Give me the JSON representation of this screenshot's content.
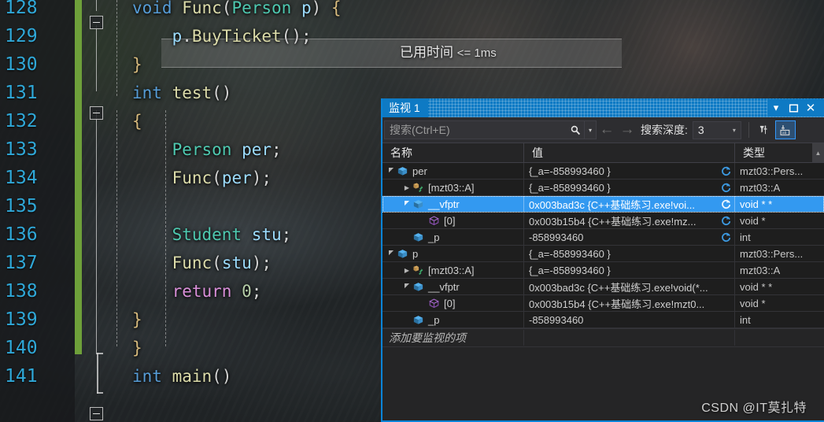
{
  "editor": {
    "elapsed_annotation": "已用时间",
    "elapsed_value": "<= 1ms",
    "lines": [
      {
        "no": "128",
        "indent": 0,
        "tokens": [
          {
            "t": "void ",
            "c": "kw"
          },
          {
            "t": "Func",
            "c": "fn"
          },
          {
            "t": "(",
            "c": "punct"
          },
          {
            "t": "Person",
            "c": "type"
          },
          {
            "t": " p",
            "c": "var"
          },
          {
            "t": ") ",
            "c": "punct"
          },
          {
            "t": "{",
            "c": "brace"
          }
        ]
      },
      {
        "no": "129",
        "indent": 0,
        "tokens": [
          {
            "t": "    p",
            "c": "var"
          },
          {
            "t": ".",
            "c": "punct"
          },
          {
            "t": "BuyTicket",
            "c": "fn"
          },
          {
            "t": "();",
            "c": "punct"
          }
        ]
      },
      {
        "no": "130",
        "indent": 0,
        "tokens": [
          {
            "t": "}",
            "c": "brace"
          }
        ]
      },
      {
        "no": "131",
        "indent": 0,
        "tokens": [
          {
            "t": "int ",
            "c": "kw"
          },
          {
            "t": "test",
            "c": "fn"
          },
          {
            "t": "()",
            "c": "punct"
          }
        ]
      },
      {
        "no": "132",
        "indent": 0,
        "tokens": [
          {
            "t": "{",
            "c": "brace"
          }
        ]
      },
      {
        "no": "133",
        "indent": 0,
        "tokens": [
          {
            "t": "    Person",
            "c": "type"
          },
          {
            "t": " per",
            "c": "var"
          },
          {
            "t": ";",
            "c": "punct"
          }
        ]
      },
      {
        "no": "134",
        "indent": 0,
        "tokens": [
          {
            "t": "    Func",
            "c": "fn"
          },
          {
            "t": "(",
            "c": "punct"
          },
          {
            "t": "per",
            "c": "var"
          },
          {
            "t": ");",
            "c": "punct"
          }
        ]
      },
      {
        "no": "135",
        "indent": 0,
        "tokens": []
      },
      {
        "no": "136",
        "indent": 0,
        "tokens": [
          {
            "t": "    Student",
            "c": "type"
          },
          {
            "t": " stu",
            "c": "var"
          },
          {
            "t": ";",
            "c": "punct"
          }
        ]
      },
      {
        "no": "137",
        "indent": 0,
        "tokens": [
          {
            "t": "    Func",
            "c": "fn"
          },
          {
            "t": "(",
            "c": "punct"
          },
          {
            "t": "stu",
            "c": "var"
          },
          {
            "t": ");",
            "c": "punct"
          }
        ]
      },
      {
        "no": "138",
        "indent": 0,
        "tokens": [
          {
            "t": "    return ",
            "c": "ret"
          },
          {
            "t": "0",
            "c": "num"
          },
          {
            "t": ";",
            "c": "punct"
          }
        ]
      },
      {
        "no": "139",
        "indent": 0,
        "tokens": [
          {
            "t": "}",
            "c": "brace"
          }
        ]
      },
      {
        "no": "140",
        "indent": 0,
        "tokens": [
          {
            "t": "}",
            "c": "brace"
          }
        ]
      },
      {
        "no": "141",
        "indent": 0,
        "tokens": [
          {
            "t": "int ",
            "c": "kw"
          },
          {
            "t": "main",
            "c": "fn"
          },
          {
            "t": "()",
            "c": "punct"
          }
        ]
      }
    ]
  },
  "watch": {
    "title": "监视 1",
    "title_buttons": {
      "dropdown": "▾",
      "maximize": "🗖",
      "close": "✕"
    },
    "toolbar": {
      "search_placeholder": "搜索(Ctrl+E)",
      "search_icon": "search-icon",
      "search_dropdown_caret": "▾",
      "back_arrow": "←",
      "forward_arrow": "→",
      "depth_label": "搜索深度:",
      "depth_value": "3",
      "depth_caret": "▾",
      "pin_filter_icon": "pin-filter-icon",
      "show_names_icon": "show-names-toggle-icon"
    },
    "columns": {
      "name": "名称",
      "value": "值",
      "type": "类型"
    },
    "add_row_placeholder": "添加要监视的项",
    "rows": [
      {
        "indent": 0,
        "expander": "expanded",
        "icon": "field-cube-icon",
        "name": "per",
        "value": "{_a=-858993460 }",
        "refresh": true,
        "type": "mzt03::Pers...",
        "selected": false
      },
      {
        "indent": 1,
        "expander": "collapsed",
        "icon": "base-class-icon",
        "name": "[mzt03::A]",
        "value": "{_a=-858993460 }",
        "refresh": true,
        "type": "mzt03::A",
        "selected": false
      },
      {
        "indent": 1,
        "expander": "expanded",
        "icon": "field-cube-icon",
        "name": "__vfptr",
        "value": "0x003bad3c {C++基础练习.exe!voi...",
        "refresh": true,
        "type": "void * *",
        "selected": true
      },
      {
        "indent": 2,
        "expander": "none",
        "icon": "pointer-cube-icon",
        "name": "[0]",
        "value": "0x003b15b4 {C++基础练习.exe!mz...",
        "refresh": true,
        "type": "void *",
        "selected": false
      },
      {
        "indent": 1,
        "expander": "none",
        "icon": "field-cube-icon",
        "name": "_p",
        "value": "-858993460",
        "refresh": true,
        "type": "int",
        "selected": false
      },
      {
        "indent": 0,
        "expander": "expanded",
        "icon": "field-cube-icon",
        "name": "p",
        "value": "{_a=-858993460 }",
        "refresh": false,
        "type": "mzt03::Pers...",
        "selected": false
      },
      {
        "indent": 1,
        "expander": "collapsed",
        "icon": "base-class-icon",
        "name": "[mzt03::A]",
        "value": "{_a=-858993460 }",
        "refresh": false,
        "type": "mzt03::A",
        "selected": false
      },
      {
        "indent": 1,
        "expander": "expanded",
        "icon": "field-cube-icon",
        "name": "__vfptr",
        "value": "0x003bad3c {C++基础练习.exe!void(*...",
        "refresh": false,
        "type": "void * *",
        "selected": false
      },
      {
        "indent": 2,
        "expander": "none",
        "icon": "pointer-cube-icon",
        "name": "[0]",
        "value": "0x003b15b4 {C++基础练习.exe!mzt0...",
        "refresh": false,
        "type": "void *",
        "selected": false
      },
      {
        "indent": 1,
        "expander": "none",
        "icon": "field-cube-icon",
        "name": "_p",
        "value": "-858993460",
        "refresh": false,
        "type": "int",
        "selected": false
      }
    ]
  },
  "watermark": "CSDN @IT莫扎特",
  "colors": {
    "title_bar": "#0e7ac4",
    "selection": "#3399f0",
    "accent_border": "#0a84d8",
    "change_bar": "#6ea03a",
    "line_number": "#2fa8d8"
  }
}
